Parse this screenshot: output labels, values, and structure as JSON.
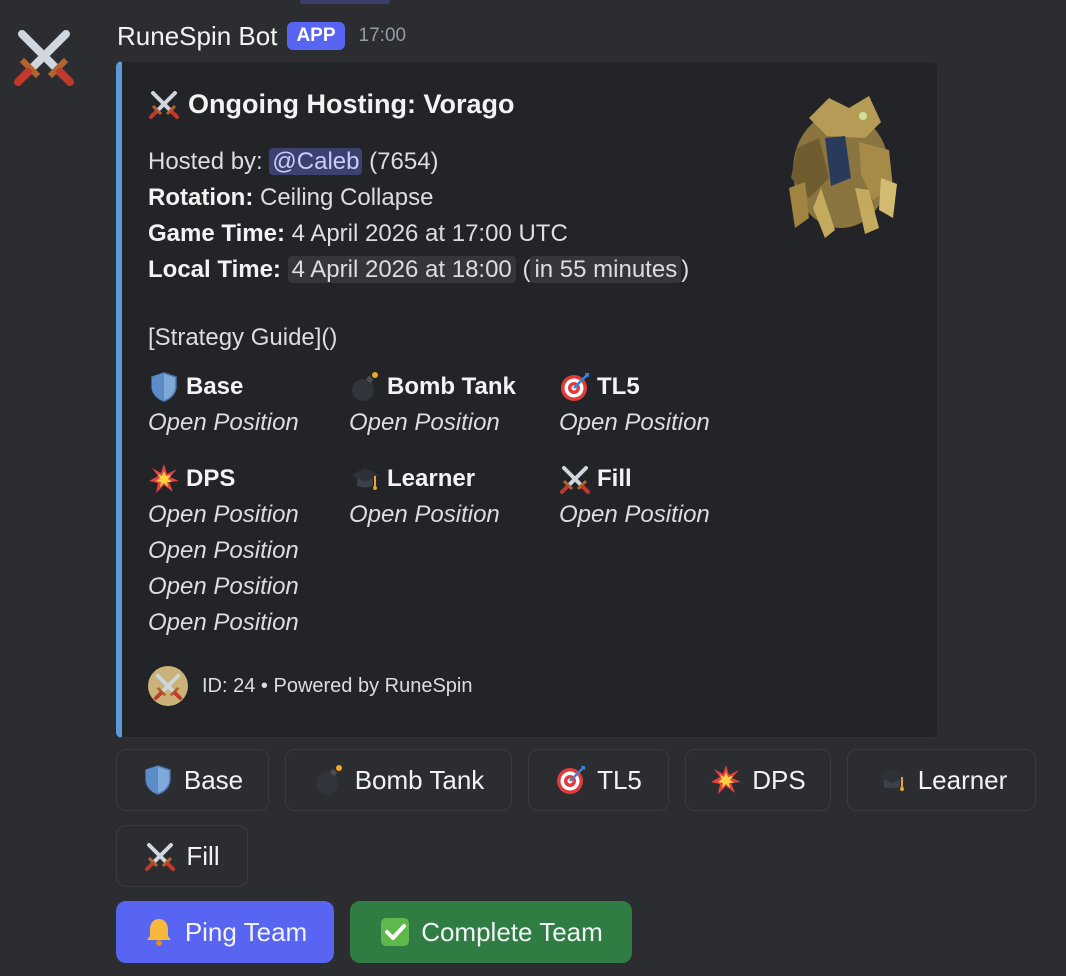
{
  "message": {
    "author": "RuneSpin Bot",
    "badge": "APP",
    "time": "17:00"
  },
  "embed": {
    "title": "Ongoing Hosting: Vorago",
    "hosted_by_label": "Hosted by:",
    "host_mention": "@Caleb",
    "host_id": "(7654)",
    "rotation_label": "Rotation:",
    "rotation_value": "Ceiling Collapse",
    "game_time_label": "Game Time:",
    "game_time_value": "4 April 2026 at 17:00 UTC",
    "local_time_label": "Local Time:",
    "local_time_value": "4 April 2026 at 18:00",
    "local_time_relative_open": "(",
    "local_time_relative": "in 55 minutes",
    "local_time_relative_close": ")",
    "guide_text": "[Strategy Guide]()",
    "fields": [
      {
        "name": "Base",
        "icon": "shield-icon",
        "values": [
          "Open Position"
        ]
      },
      {
        "name": "Bomb Tank",
        "icon": "bomb-icon",
        "values": [
          "Open Position"
        ]
      },
      {
        "name": "TL5",
        "icon": "target-icon",
        "values": [
          "Open Position"
        ]
      },
      {
        "name": "DPS",
        "icon": "collision-icon",
        "values": [
          "Open Position",
          "Open Position",
          "Open Position",
          "Open Position"
        ]
      },
      {
        "name": "Learner",
        "icon": "graduation-cap-icon",
        "values": [
          "Open Position"
        ]
      },
      {
        "name": "Fill",
        "icon": "crossed-swords-icon",
        "values": [
          "Open Position"
        ]
      }
    ],
    "footer": "ID: 24 • Powered by RuneSpin"
  },
  "buttons": {
    "base": "Base",
    "bomb_tank": "Bomb Tank",
    "tl5": "TL5",
    "dps": "DPS",
    "learner": "Learner",
    "fill": "Fill",
    "ping_team": "Ping Team",
    "complete_team": "Complete Team"
  },
  "colors": {
    "background": "#2b2d31",
    "embed_bg": "#232428",
    "embed_accent": "#5b9bd5",
    "blurple": "#5865f2",
    "success": "#2f7d43"
  }
}
